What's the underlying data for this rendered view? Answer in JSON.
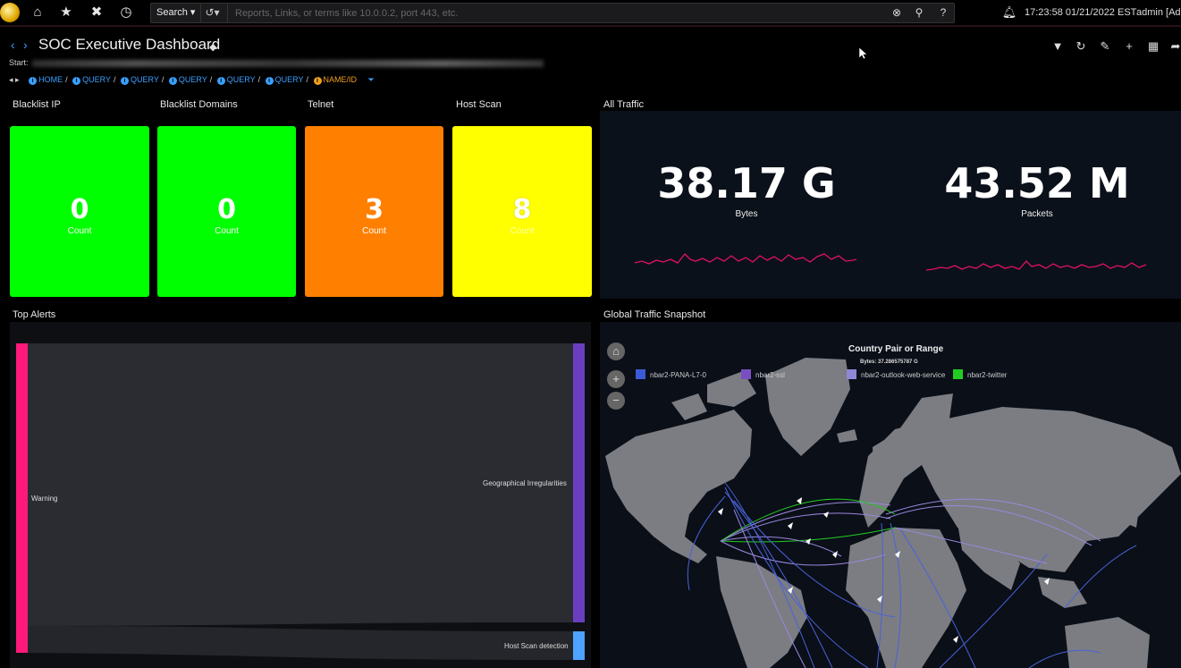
{
  "topbar": {
    "search_label": "Search",
    "search_placeholder": "Reports, Links, or terms like 10.0.0.2, port 443, etc.",
    "clock": "17:23:58 01/21/2022 EST",
    "user": "admin [Adr",
    "icons": [
      "app-logo",
      "home-icon",
      "star-icon",
      "tools-icon",
      "clock-icon",
      "history-icon",
      "clear-icon",
      "search-icon",
      "help-icon",
      "bell-icon"
    ]
  },
  "header": {
    "title": "SOC Executive Dashboard",
    "start_label": "Start:",
    "breadcrumbs": [
      "HOME",
      "QUERY",
      "QUERY",
      "QUERY",
      "QUERY",
      "QUERY",
      "NAME/ID"
    ]
  },
  "tiles": [
    {
      "title": "Blacklist IP",
      "value": "0",
      "label": "Count",
      "color": "#00ff00"
    },
    {
      "title": "Blacklist Domains",
      "value": "0",
      "label": "Count",
      "color": "#00ff00"
    },
    {
      "title": "Telnet",
      "value": "3",
      "label": "Count",
      "color": "#ff8000"
    },
    {
      "title": "Host Scan",
      "value": "8",
      "label": "Count",
      "color": "#ffff00"
    }
  ],
  "all_traffic": {
    "title": "All Traffic",
    "bytes_value": "38.17 G",
    "bytes_label": "Bytes",
    "packets_value": "43.52 M",
    "packets_label": "Packets",
    "sparkline_color": "#e0106a"
  },
  "top_alerts": {
    "title": "Top Alerts",
    "source": "Warning",
    "targets": [
      "Geographical Irregularities",
      "Host Scan detection"
    ],
    "colors": {
      "source": "#ff1a7a",
      "geo": "#6a3fbf",
      "hostscan": "#4da3ff"
    }
  },
  "map": {
    "title": "Global Traffic Snapshot",
    "legend_title": "Country Pair or Range",
    "legend_subtitle": "Bytes: 37.286575787 G",
    "legend": [
      {
        "name": "nbar2-PANA-L7-0",
        "color": "#3b5bd6"
      },
      {
        "name": "nbar2-ssl",
        "color": "#7a4fc2"
      },
      {
        "name": "nbar2-outlook-web-service",
        "color": "#8f86d8"
      },
      {
        "name": "nbar2-twitter",
        "color": "#22cc22"
      }
    ]
  }
}
